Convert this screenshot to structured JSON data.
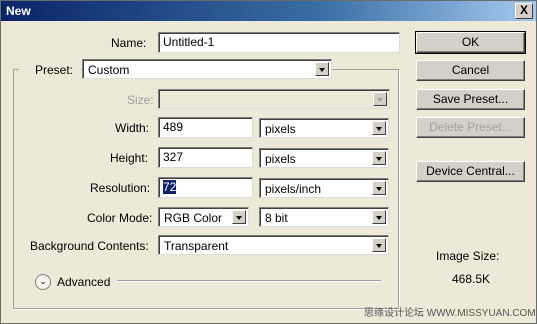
{
  "window": {
    "title": "New",
    "close_label": "X"
  },
  "form": {
    "name_label": "Name:",
    "name_value": "Untitled-1",
    "preset_label": "Preset:",
    "preset_value": "Custom",
    "size_label": "Size:",
    "size_value": "",
    "width_label": "Width:",
    "width_value": "489",
    "width_unit": "pixels",
    "height_label": "Height:",
    "height_value": "327",
    "height_unit": "pixels",
    "resolution_label": "Resolution:",
    "resolution_value": "72",
    "resolution_unit": "pixels/inch",
    "color_mode_label": "Color Mode:",
    "color_mode_value": "RGB Color",
    "bit_depth_value": "8 bit",
    "background_label": "Background Contents:",
    "background_value": "Transparent",
    "advanced_label": "Advanced"
  },
  "buttons": {
    "ok": "OK",
    "cancel": "Cancel",
    "save_preset": "Save Preset...",
    "delete_preset": "Delete Preset...",
    "device_central": "Device Central..."
  },
  "info": {
    "image_size_label": "Image Size:",
    "image_size_value": "468.5K"
  },
  "watermark": "思缘设计论坛 WWW.MISSYUAN.COM",
  "colors": {
    "dialog_bg": "#ece9d8",
    "title_start": "#0a246a",
    "title_end": "#a6caf0",
    "selection": "#0a246a"
  },
  "icons": {
    "close": "close-icon",
    "dropdown": "chevron-down-icon",
    "advanced": "expand-chevron-icon"
  }
}
